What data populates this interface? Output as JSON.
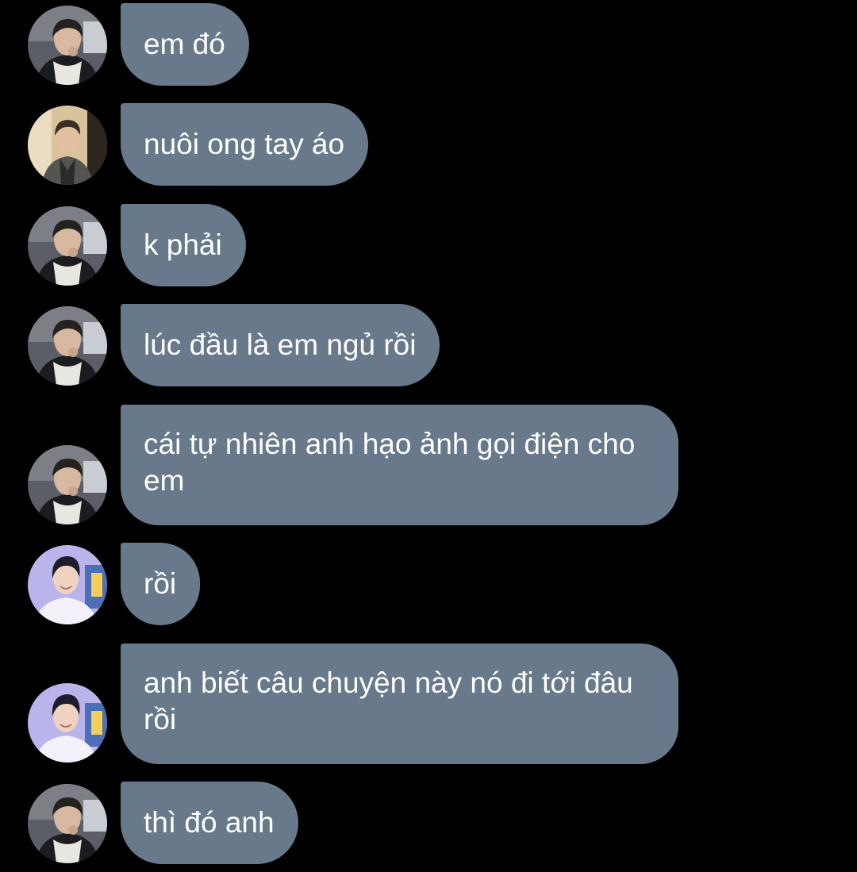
{
  "messages": [
    {
      "avatar": "avatar-dark-jacket-icon",
      "text": "em đó"
    },
    {
      "avatar": "avatar-gray-jacket-icon",
      "text": "nuôi ong tay áo"
    },
    {
      "avatar": "avatar-dark-jacket-icon",
      "text": "k phải"
    },
    {
      "avatar": "avatar-dark-jacket-icon",
      "text": "lúc đầu là em ngủ rồi"
    },
    {
      "avatar": "avatar-dark-jacket-icon",
      "text": "cái tự nhiên anh hạo ảnh gọi điện cho em"
    },
    {
      "avatar": "avatar-smiling-blue-icon",
      "text": "rồi"
    },
    {
      "avatar": "avatar-smiling-blue-icon",
      "text": "anh biết câu chuyện này nó đi tới đâu rồi"
    },
    {
      "avatar": "avatar-dark-jacket-icon",
      "text": "thì đó anh"
    }
  ],
  "colors": {
    "background": "#000000",
    "bubble": "#67798a",
    "text": "#ffffff"
  }
}
